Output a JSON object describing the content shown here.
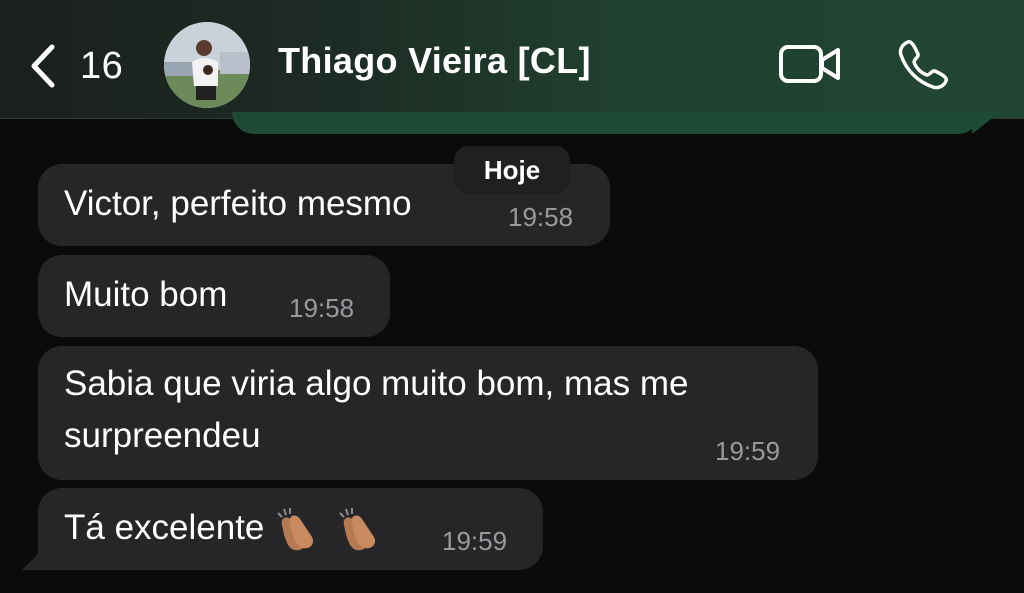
{
  "header": {
    "back_count": "16",
    "contact_name": "Thiago Vieira [CL]"
  },
  "date_separator": "Hoje",
  "messages": [
    {
      "text": "Victor, perfeito mesmo",
      "time": "19:58"
    },
    {
      "text": "Muito bom",
      "time": "19:58"
    },
    {
      "text": "Sabia que viria algo muito bom, mas me surpreendeu",
      "time": "19:59"
    },
    {
      "text": "Tá excelente",
      "time": "19:59"
    }
  ],
  "colors": {
    "background": "#0b0b0c",
    "bubble": "#262628",
    "header_accent": "#214534",
    "timestamp": "#9a9a9e"
  }
}
